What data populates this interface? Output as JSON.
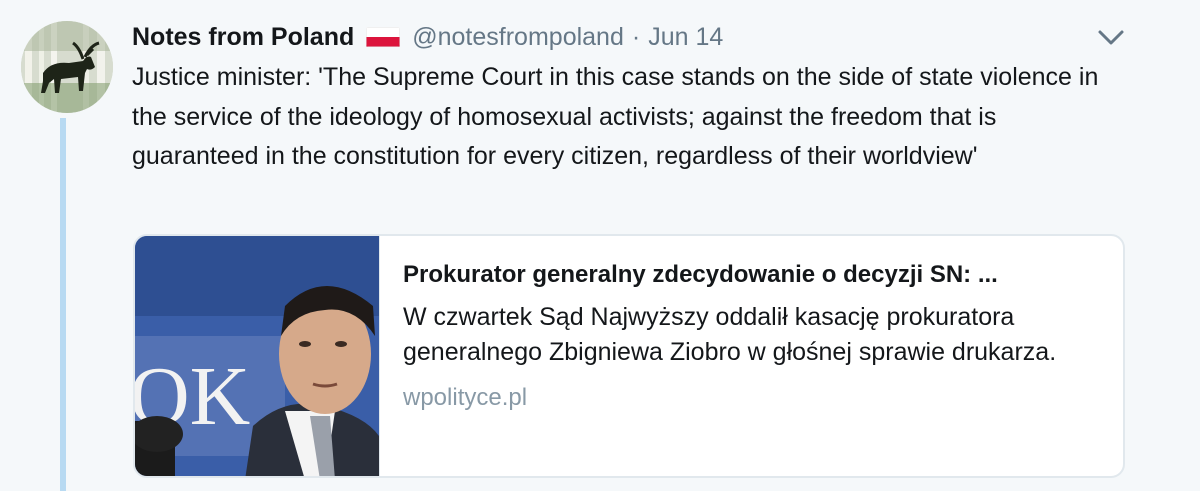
{
  "tweet": {
    "author_name": "Notes from Poland",
    "handle": "@notesfrompoland",
    "separator": "·",
    "date": "Jun 14",
    "text": "Justice minister: 'The Supreme Court in this case stands on the side of state violence in the service of the ideology of homosexual activists; against the freedom that is guaranteed in the constitution for every citizen, regardless of their worldview'",
    "flag_icon": "poland-flag-emoji",
    "menu_icon": "chevron-down-icon"
  },
  "card": {
    "title": "Prokurator generalny zdecydowanie o decyzji SN: ...",
    "description": "W czwartek Sąd Najwyższy oddalił kasację prokuratora generalnego Zbigniewa Ziobro w głośnej sprawie drukarza.",
    "domain": "wpolityce.pl",
    "image_backdrop_text": "OK"
  },
  "colors": {
    "background": "#f5f8fa",
    "thread_line": "#b8daf2",
    "secondary_text": "#657786",
    "card_border": "#e1e8ed",
    "flag_white": "#ffffff",
    "flag_red": "#dc143c"
  }
}
